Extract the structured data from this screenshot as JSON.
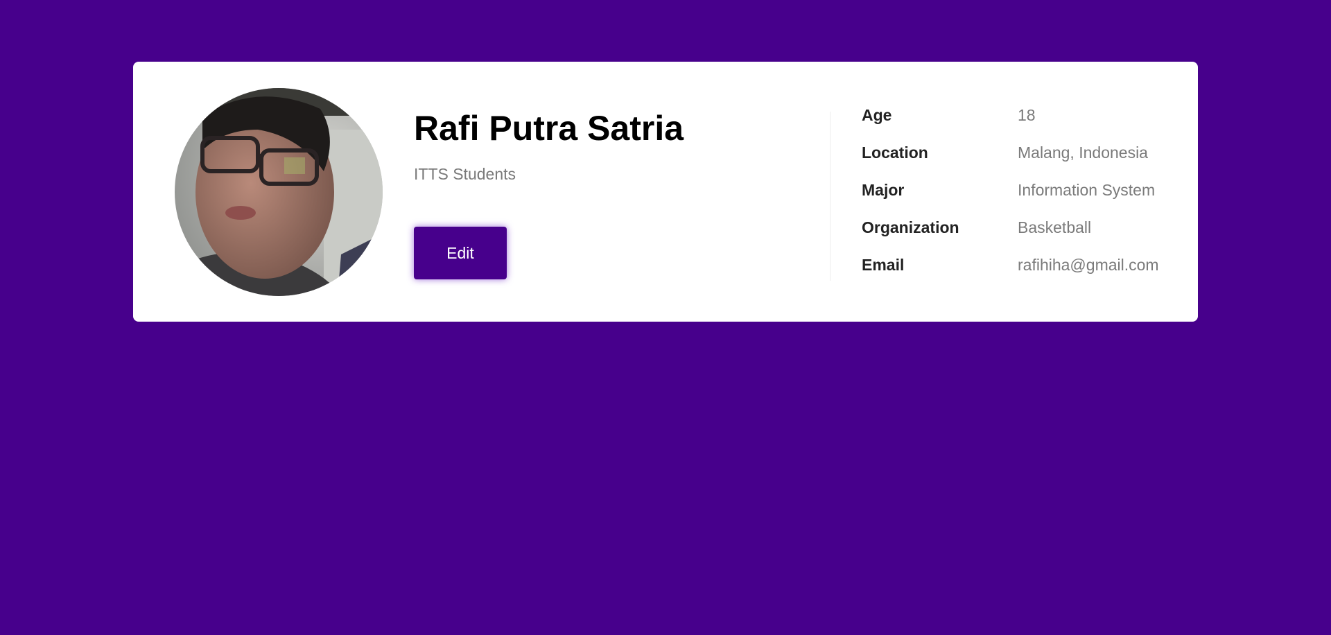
{
  "colors": {
    "page_background": "#47008c",
    "card_background": "#ffffff",
    "button_background": "#47008c"
  },
  "profile": {
    "name": "Rafi Putra Satria",
    "subtitle": "ITTS Students",
    "edit_label": "Edit",
    "avatar_icon": "profile-photo"
  },
  "details": [
    {
      "label": "Age",
      "value": "18"
    },
    {
      "label": "Location",
      "value": "Malang, Indonesia"
    },
    {
      "label": "Major",
      "value": "Information System"
    },
    {
      "label": "Organization",
      "value": "Basketball"
    },
    {
      "label": "Email",
      "value": "rafihiha@gmail.com"
    }
  ]
}
